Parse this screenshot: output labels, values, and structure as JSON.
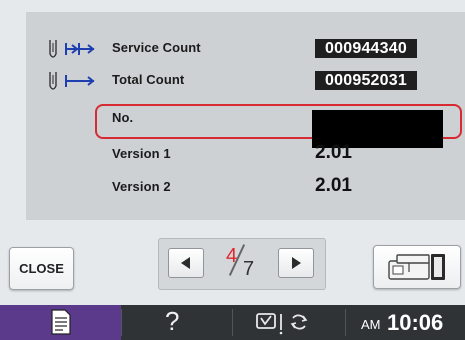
{
  "rows": [
    {
      "label": "Service Count",
      "value": "000944340",
      "icon": "needle-double-arrow-icon"
    },
    {
      "label": "Total Count",
      "value": "000952031",
      "icon": "needle-arrow-icon"
    },
    {
      "label": "No.",
      "value": ""
    },
    {
      "label": "Version 1",
      "value": "2.01"
    },
    {
      "label": "Version 2",
      "value": "2.01"
    }
  ],
  "controls": {
    "close_label": "CLOSE",
    "page_current": "4",
    "page_total": "7"
  },
  "taskbar": {
    "help": "?",
    "clock_ampm": "AM",
    "clock_time": "10:06"
  },
  "colors": {
    "highlight": "#d72a33",
    "page_current": "#e0262e",
    "taskbar_active": "#5b3a8c",
    "counter_bg": "#1f1f1f",
    "icon_blue": "#1f3fb0"
  }
}
